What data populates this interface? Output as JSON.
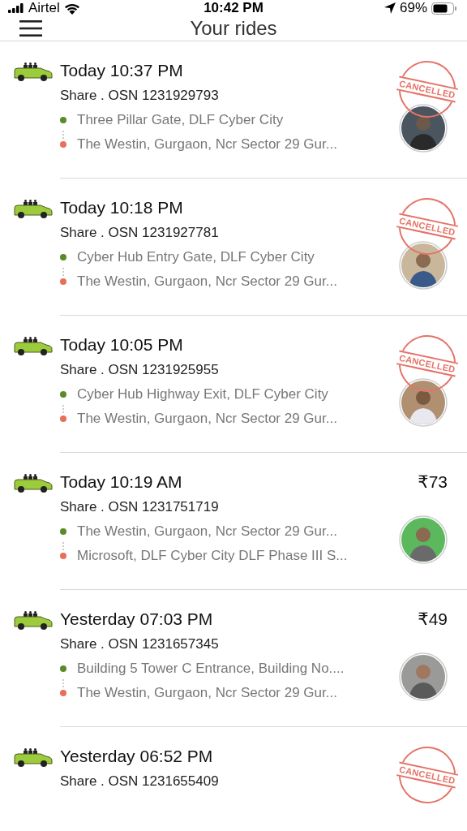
{
  "status_bar": {
    "carrier": "Airtel",
    "time": "10:42 PM",
    "battery": "69%"
  },
  "header": {
    "title": "Your rides"
  },
  "rides": [
    {
      "time": "Today 10:37 PM",
      "service": "Share . OSN 1231929793",
      "pickup": "Three Pillar Gate, DLF Cyber City",
      "drop": "The Westin, Gurgaon, Ncr Sector 29 Gur...",
      "cancelled": true,
      "stamp": "CANCELLED"
    },
    {
      "time": "Today 10:18 PM",
      "service": "Share . OSN 1231927781",
      "pickup": "Cyber Hub Entry Gate, DLF Cyber City",
      "drop": "The Westin, Gurgaon, Ncr Sector 29 Gur...",
      "cancelled": true,
      "stamp": "CANCELLED"
    },
    {
      "time": "Today 10:05 PM",
      "service": "Share . OSN 1231925955",
      "pickup": "Cyber Hub Highway Exit, DLF Cyber City",
      "drop": "The Westin, Gurgaon, Ncr Sector 29 Gur...",
      "cancelled": true,
      "stamp": "CANCELLED"
    },
    {
      "time": "Today 10:19 AM",
      "service": "Share . OSN 1231751719",
      "pickup": "The Westin, Gurgaon, Ncr Sector 29 Gur...",
      "drop": "Microsoft, DLF Cyber City DLF Phase III S...",
      "cancelled": false,
      "fare": "₹73"
    },
    {
      "time": "Yesterday 07:03 PM",
      "service": "Share . OSN 1231657345",
      "pickup": "Building 5 Tower C Entrance, Building No....",
      "drop": "The Westin, Gurgaon, Ncr Sector 29 Gur...",
      "cancelled": false,
      "fare": "₹49"
    },
    {
      "time": "Yesterday 06:52 PM",
      "service": "Share . OSN 1231655409",
      "cancelled": true,
      "stamp": "CANCELLED"
    }
  ]
}
